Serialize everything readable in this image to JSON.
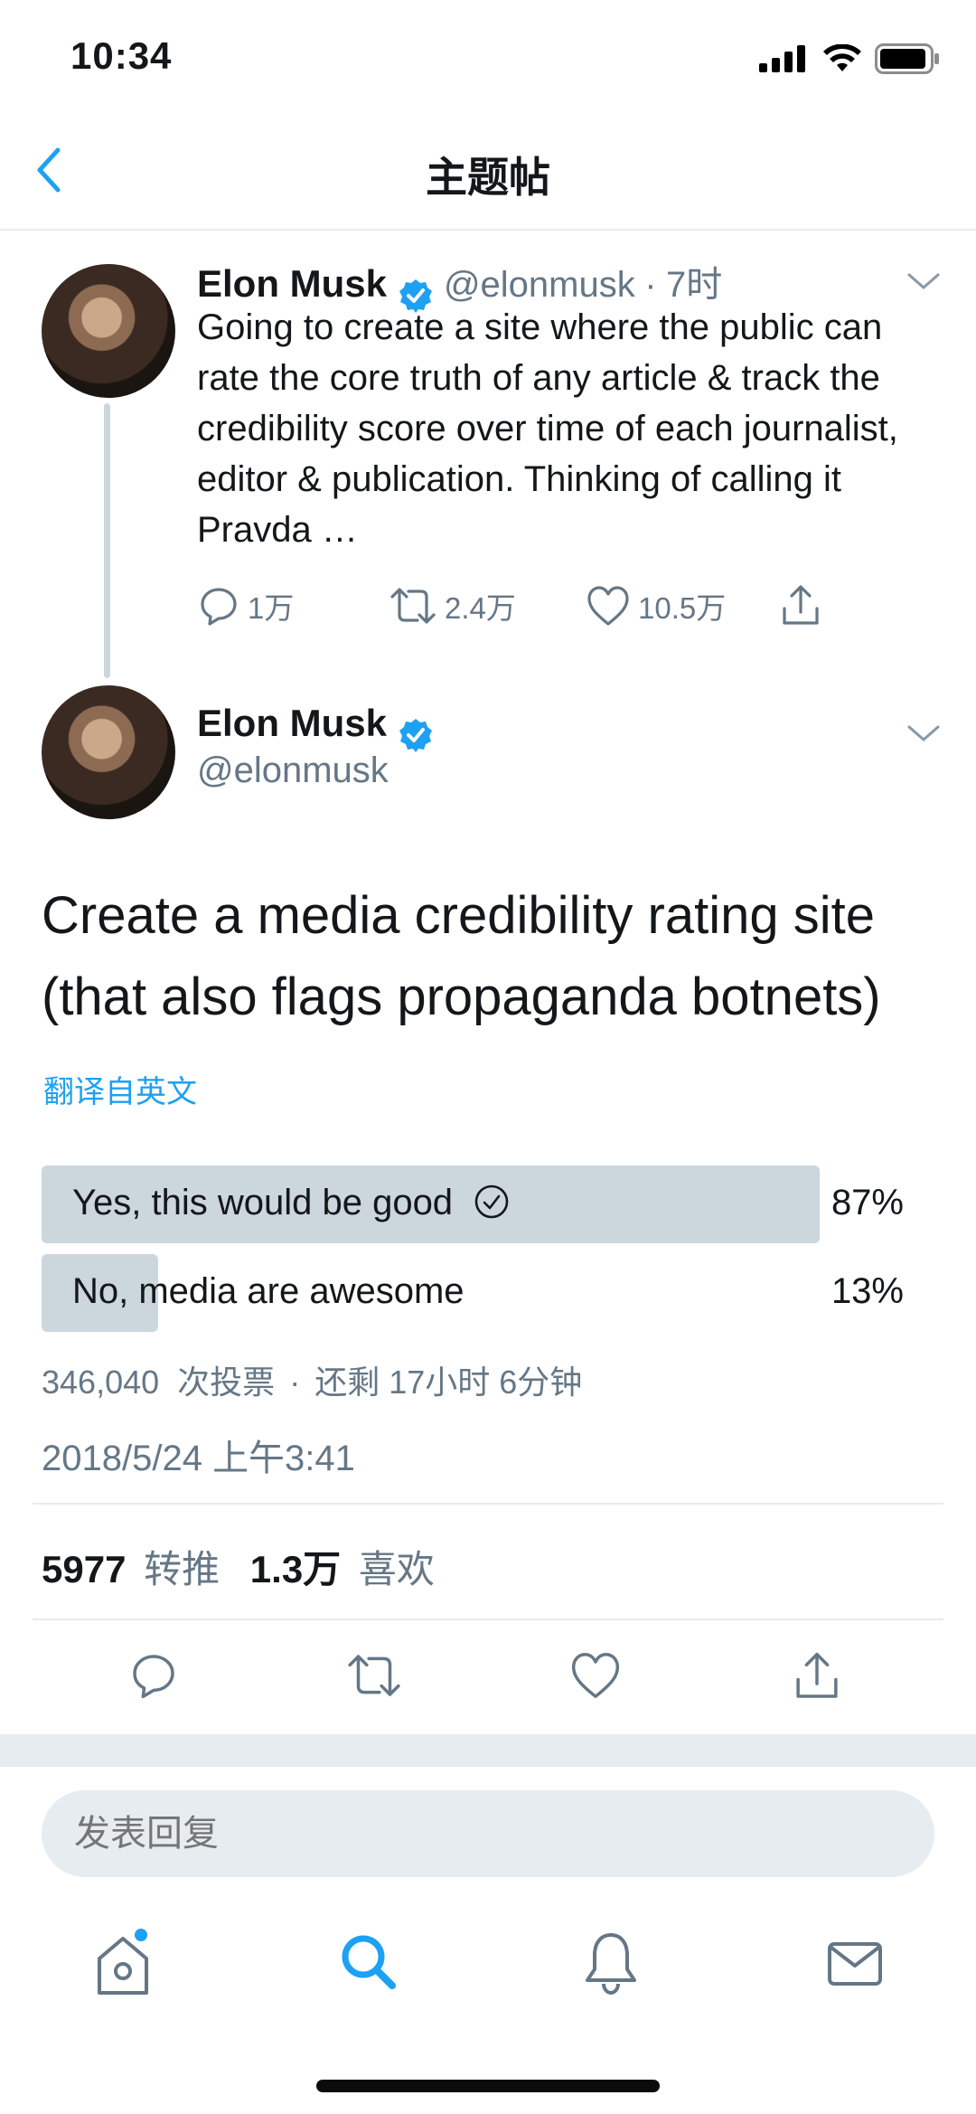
{
  "status_bar": {
    "time": "10:34"
  },
  "header": {
    "title": "主题帖"
  },
  "tweet_parent": {
    "name": "Elon Musk",
    "handle": "@elonmusk",
    "separator": "·",
    "time": "7时",
    "text": "Going to create a site where the public can rate the core truth of any article & track the credibility score over time of each journalist, editor & publication. Thinking of calling it Pravda …",
    "replies": "1万",
    "retweets": "2.4万",
    "likes": "10.5万"
  },
  "tweet_main": {
    "name": "Elon Musk",
    "handle": "@elonmusk",
    "text_line1": "Create a media credibility rating site",
    "text_line2": "(that also flags propaganda botnets)",
    "translate": "翻译自英文",
    "poll": {
      "options": [
        {
          "label": "Yes, this would be good",
          "percent": "87%",
          "fraction": 0.87,
          "selected": true
        },
        {
          "label": "No, media are awesome",
          "percent": "13%",
          "fraction": 0.13,
          "selected": false
        }
      ],
      "votes_count": "346,040",
      "votes_label": "次投票",
      "separator": "·",
      "remaining": "还剩 17小时 6分钟"
    },
    "timestamp": "2018/5/24 上午3:41",
    "retweet_count": "5977",
    "retweet_label": "转推",
    "like_count": "1.3万",
    "like_label": "喜欢"
  },
  "reply": {
    "placeholder": "发表回复"
  },
  "colors": {
    "accent": "#1da1f2",
    "text": "#14171a",
    "secondary": "#657786",
    "poll_bar": "#ccd6dd",
    "divider": "#e6ecf0"
  },
  "tabbar": {
    "icons": [
      "home-icon",
      "search-icon",
      "notifications-icon",
      "messages-icon"
    ]
  }
}
